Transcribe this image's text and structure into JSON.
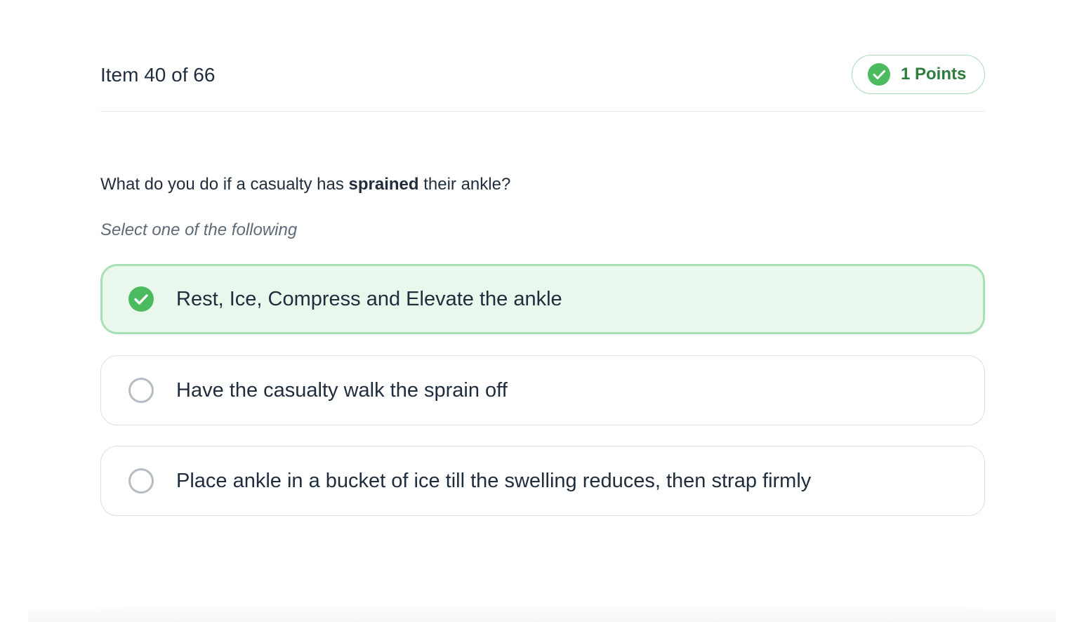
{
  "header": {
    "item_counter": "Item 40 of 66",
    "points_label": "1 Points"
  },
  "question": {
    "text_before": "What do you do if a casualty has ",
    "text_bold": "sprained",
    "text_after": " their ankle?",
    "instruction": "Select one of the following"
  },
  "options": [
    {
      "label": "Rest, Ice, Compress and Elevate the ankle",
      "selected": true
    },
    {
      "label": "Have the casualty walk the sprain off",
      "selected": false
    },
    {
      "label": "Place ankle in a bucket of ice till the swelling reduces, then strap firmly",
      "selected": false
    }
  ],
  "icons": {
    "badge": "check-circle-icon",
    "selected_option": "check-circle-icon",
    "unselected_option": "radio-empty-icon"
  },
  "colors": {
    "accent_green": "#4cbb5f",
    "selected_bg": "#e9f7ec",
    "selected_border": "#a8e0b6",
    "points_text": "#2e7d3e",
    "text_primary": "#1f2d3d",
    "text_muted": "#5d6a78"
  }
}
